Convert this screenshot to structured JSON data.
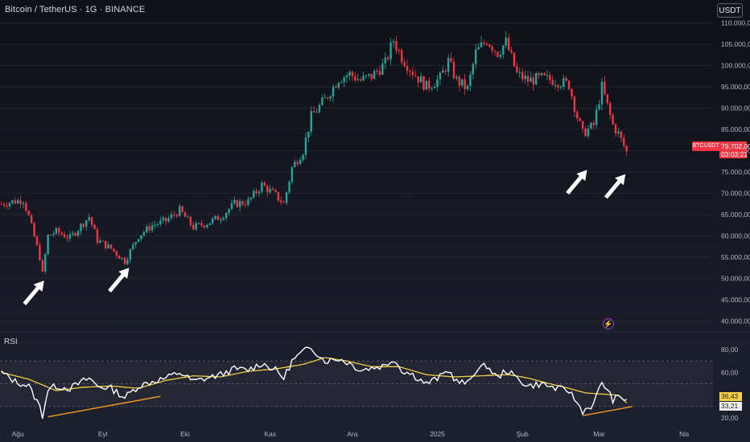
{
  "header": {
    "title": "Bitcoin / TetherUS · 1G · BINANCE",
    "currency_button": "USDT"
  },
  "colors": {
    "up": "#26a69a",
    "down": "#f23645",
    "rsi_line": "#ffffff",
    "rsi_ma": "#f0d040",
    "trendline": "#f39c1f",
    "arrow": "#ffffff"
  },
  "chart_data": [
    {
      "type": "candlestick",
      "symbol_label": "BTCUSDT",
      "last_price_label": "79.702,00",
      "countdown_label": "03:03:21",
      "ylim": [
        38000,
        112000
      ],
      "y_ticks": [
        40000,
        45000,
        50000,
        55000,
        60000,
        65000,
        70000,
        75000,
        80000,
        85000,
        90000,
        95000,
        100000,
        105000,
        110000
      ],
      "y_tick_labels": [
        "40.000,00",
        "45.000,00",
        "50.000,00",
        "55.000,00",
        "60.000,00",
        "65.000,00",
        "70.000,00",
        "75.000,00",
        "80.000,00",
        "85.000,00",
        "90.000,00",
        "95.000,00",
        "100.000,00",
        "105.000,00",
        "110.000,00"
      ],
      "x_labels": [
        {
          "index": 6,
          "label": "Ağu"
        },
        {
          "index": 37,
          "label": "Eyl"
        },
        {
          "index": 67,
          "label": "Eki"
        },
        {
          "index": 98,
          "label": "Kas"
        },
        {
          "index": 128,
          "label": "Ara"
        },
        {
          "index": 159,
          "label": "2025"
        },
        {
          "index": 190,
          "label": "Şub"
        },
        {
          "index": 218,
          "label": "Mar"
        },
        {
          "index": 249,
          "label": "Nis"
        }
      ],
      "x_count": 260,
      "close_path": [
        [
          0,
          67500
        ],
        [
          8,
          68500
        ],
        [
          10,
          64500
        ],
        [
          14,
          55000
        ],
        [
          15,
          51000
        ],
        [
          17,
          60000
        ],
        [
          20,
          61000
        ],
        [
          25,
          59500
        ],
        [
          32,
          64500
        ],
        [
          35,
          59000
        ],
        [
          40,
          57000
        ],
        [
          45,
          54000
        ],
        [
          50,
          60000
        ],
        [
          55,
          62500
        ],
        [
          60,
          63500
        ],
        [
          65,
          66000
        ],
        [
          70,
          62000
        ],
        [
          75,
          63000
        ],
        [
          80,
          64500
        ],
        [
          85,
          67500
        ],
        [
          90,
          68000
        ],
        [
          95,
          72000
        ],
        [
          100,
          69500
        ],
        [
          103,
          67500
        ],
        [
          106,
          76000
        ],
        [
          110,
          80000
        ],
        [
          113,
          88000
        ],
        [
          118,
          92000
        ],
        [
          123,
          97000
        ],
        [
          127,
          98000
        ],
        [
          131,
          96500
        ],
        [
          135,
          97500
        ],
        [
          140,
          100500
        ],
        [
          143,
          106000
        ],
        [
          146,
          102000
        ],
        [
          150,
          98500
        ],
        [
          155,
          95000
        ],
        [
          160,
          97000
        ],
        [
          163,
          101000
        ],
        [
          166,
          96500
        ],
        [
          170,
          94500
        ],
        [
          173,
          103000
        ],
        [
          177,
          106000
        ],
        [
          181,
          103000
        ],
        [
          184,
          105500
        ],
        [
          188,
          98000
        ],
        [
          192,
          96500
        ],
        [
          197,
          97000
        ],
        [
          202,
          96500
        ],
        [
          207,
          95500
        ],
        [
          210,
          88000
        ],
        [
          212,
          84000
        ],
        [
          216,
          86000
        ],
        [
          219,
          95000
        ],
        [
          223,
          86000
        ],
        [
          225,
          84000
        ],
        [
          228,
          79702
        ]
      ],
      "annotations": [
        {
          "type": "arrow",
          "target_index": 15,
          "target_price": 51000
        },
        {
          "type": "arrow",
          "target_index": 46,
          "target_price": 54000
        },
        {
          "type": "arrow",
          "target_index": 213,
          "target_price": 77000
        },
        {
          "type": "arrow",
          "target_index": 227,
          "target_price": 76000
        }
      ]
    },
    {
      "type": "line",
      "title": "RSI",
      "ylim": [
        13,
        92
      ],
      "y_ticks": [
        20,
        40,
        60,
        80
      ],
      "y_tick_labels": [
        "20,00",
        "40,00",
        "60,00",
        "80,00"
      ],
      "bands": [
        30,
        50,
        70
      ],
      "rsi_value_label": "36,43",
      "ma_value_label": "33,21",
      "rsi_path": [
        [
          0,
          60
        ],
        [
          5,
          52
        ],
        [
          10,
          48
        ],
        [
          14,
          30
        ],
        [
          15,
          22
        ],
        [
          17,
          45
        ],
        [
          20,
          48
        ],
        [
          25,
          46
        ],
        [
          32,
          55
        ],
        [
          35,
          48
        ],
        [
          40,
          46
        ],
        [
          45,
          38
        ],
        [
          50,
          48
        ],
        [
          55,
          52
        ],
        [
          60,
          55
        ],
        [
          65,
          60
        ],
        [
          70,
          52
        ],
        [
          75,
          55
        ],
        [
          80,
          58
        ],
        [
          85,
          63
        ],
        [
          90,
          62
        ],
        [
          95,
          68
        ],
        [
          100,
          62
        ],
        [
          103,
          55
        ],
        [
          106,
          70
        ],
        [
          110,
          78
        ],
        [
          113,
          82
        ],
        [
          118,
          70
        ],
        [
          123,
          72
        ],
        [
          127,
          68
        ],
        [
          131,
          62
        ],
        [
          135,
          64
        ],
        [
          140,
          66
        ],
        [
          143,
          72
        ],
        [
          146,
          62
        ],
        [
          150,
          58
        ],
        [
          155,
          50
        ],
        [
          160,
          56
        ],
        [
          163,
          62
        ],
        [
          166,
          52
        ],
        [
          170,
          50
        ],
        [
          173,
          62
        ],
        [
          177,
          66
        ],
        [
          181,
          55
        ],
        [
          184,
          62
        ],
        [
          188,
          55
        ],
        [
          192,
          48
        ],
        [
          197,
          50
        ],
        [
          202,
          46
        ],
        [
          207,
          44
        ],
        [
          210,
          33
        ],
        [
          212,
          26
        ],
        [
          216,
          32
        ],
        [
          219,
          52
        ],
        [
          223,
          36
        ],
        [
          225,
          38
        ],
        [
          228,
          36.43
        ]
      ],
      "ma_path": [
        [
          0,
          60
        ],
        [
          10,
          54
        ],
        [
          20,
          44
        ],
        [
          30,
          47
        ],
        [
          40,
          48
        ],
        [
          50,
          46
        ],
        [
          60,
          53
        ],
        [
          70,
          57
        ],
        [
          80,
          56
        ],
        [
          90,
          61
        ],
        [
          100,
          63
        ],
        [
          110,
          67
        ],
        [
          118,
          73
        ],
        [
          126,
          70
        ],
        [
          135,
          65
        ],
        [
          145,
          65
        ],
        [
          155,
          58
        ],
        [
          165,
          56
        ],
        [
          175,
          57
        ],
        [
          185,
          58
        ],
        [
          192,
          55
        ],
        [
          200,
          50
        ],
        [
          207,
          46
        ],
        [
          213,
          42
        ],
        [
          219,
          41
        ],
        [
          225,
          40
        ],
        [
          228,
          33.21
        ]
      ],
      "trendlines": [
        {
          "from": [
            17,
            21
          ],
          "to": [
            58,
            39
          ]
        },
        {
          "from": [
            212,
            22
          ],
          "to": [
            230,
            30
          ]
        }
      ]
    }
  ]
}
